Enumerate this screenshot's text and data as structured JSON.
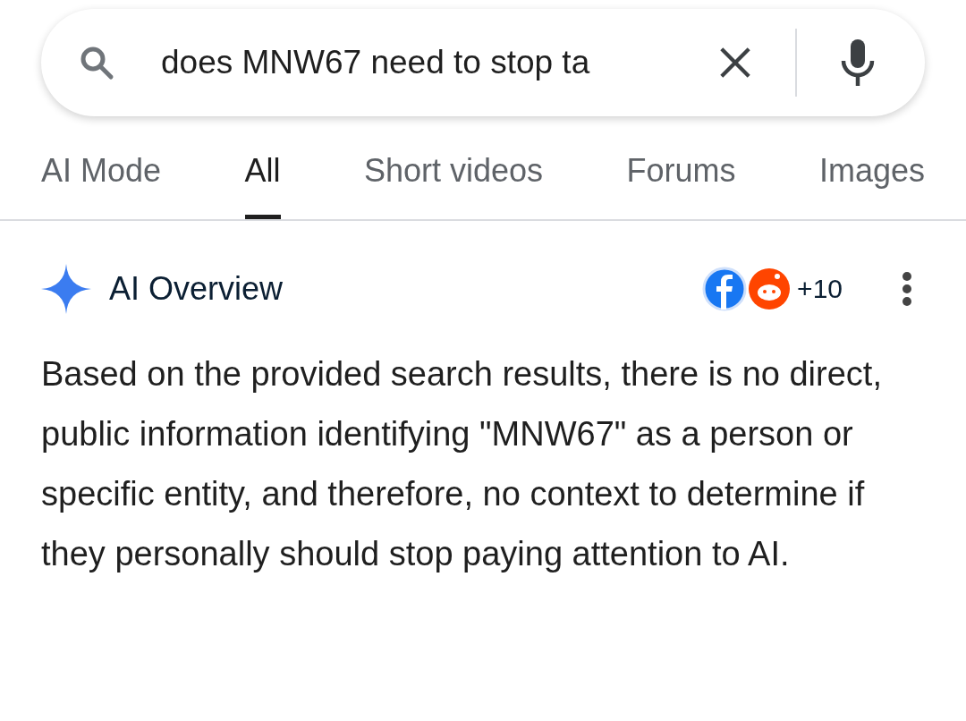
{
  "search": {
    "value": "does MNW67 need to stop ta"
  },
  "tabs": [
    {
      "label": "AI Mode",
      "selected": false
    },
    {
      "label": "All",
      "selected": true
    },
    {
      "label": "Short videos",
      "selected": false
    },
    {
      "label": "Forums",
      "selected": false
    },
    {
      "label": "Images",
      "selected": false
    }
  ],
  "ai_overview": {
    "title": "AI Overview",
    "sources_count": "+10",
    "text": "Based on the provided search results, there is no direct, public information identifying \"MNW67\" as a person or specific entity, and therefore, no context to determine if they personally should stop paying attention to AI."
  }
}
